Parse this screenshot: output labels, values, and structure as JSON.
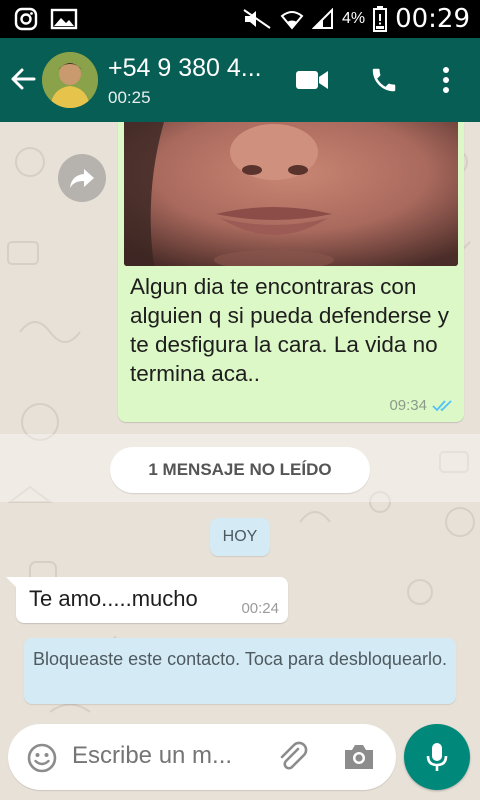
{
  "status_bar": {
    "time": "00:29",
    "battery": "4%"
  },
  "header": {
    "contact": "+54 9 380 4...",
    "status": "00:25"
  },
  "messages": {
    "outgoing_text": "Algun dia te encontraras con alguien q si pueda defenderse y te desfigura la cara. La vida no termina aca..",
    "outgoing_time": "09:34",
    "unread_label": "1 MENSAJE NO LEÍDO",
    "date_label": "HOY",
    "incoming_text": "Te amo.....mucho",
    "incoming_time": "00:24",
    "system_notice": "Bloqueaste este contacto. Toca para desbloquearlo."
  },
  "composer": {
    "placeholder": "Escribe un m..."
  },
  "colors": {
    "header": "#075e54",
    "outgoing_bubble": "#dcf8c6",
    "accent": "#00897b",
    "read_ticks": "#4fc3f7"
  }
}
